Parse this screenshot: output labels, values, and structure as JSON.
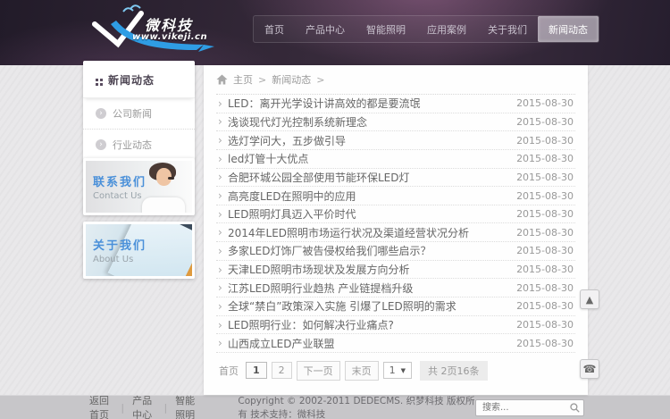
{
  "colors": {
    "accent_blue": "#4a90d9",
    "header_dark": "#2a2130",
    "footer_bg": "#c7c6c9",
    "banner_orange": "#df9b3f"
  },
  "header": {
    "logo": {
      "name": "微科技",
      "url": "www.vikeji.cn"
    },
    "nav_items": [
      {
        "label": "首页",
        "active": false
      },
      {
        "label": "产品中心",
        "active": false
      },
      {
        "label": "智能照明",
        "active": false
      },
      {
        "label": "应用案例",
        "active": false
      },
      {
        "label": "关于我们",
        "active": false
      },
      {
        "label": "新闻动态",
        "active": true
      }
    ]
  },
  "sidebar": {
    "title": "新闻动态",
    "links": [
      {
        "label": "公司新闻"
      },
      {
        "label": "行业动态"
      }
    ],
    "banners": [
      {
        "title": "联系我们",
        "subtitle": "Contact Us"
      },
      {
        "title": "关于我们",
        "subtitle": "About Us"
      }
    ]
  },
  "main": {
    "breadcrumb": {
      "items": [
        {
          "label": "主页"
        },
        {
          "label": "新闻动态"
        }
      ],
      "separator": ">"
    },
    "news_items": [
      {
        "title": "LED：离开光学设计讲高效的都是要流氓",
        "date": "2015-08-30"
      },
      {
        "title": "浅谈现代灯光控制系统新理念",
        "date": "2015-08-30"
      },
      {
        "title": "选灯学问大，五步做引导",
        "date": "2015-08-30"
      },
      {
        "title": "led灯管十大优点",
        "date": "2015-08-30"
      },
      {
        "title": "合肥环城公园全部使用节能环保LED灯",
        "date": "2015-08-30"
      },
      {
        "title": "高亮度LED在照明中的应用",
        "date": "2015-08-30"
      },
      {
        "title": "LED照明灯具迈入平价时代",
        "date": "2015-08-30"
      },
      {
        "title": "2014年LED照明市场运行状况及渠道经营状况分析",
        "date": "2015-08-30"
      },
      {
        "title": "多家LED灯饰厂被告侵权给我们哪些启示？",
        "date": "2015-08-30"
      },
      {
        "title": "天津LED照明市场现状及发展方向分析",
        "date": "2015-08-30"
      },
      {
        "title": "江苏LED照明行业趋热 产业链提档升级",
        "date": "2015-08-30"
      },
      {
        "title": "全球“禁白”政策深入实施 引爆了LED照明的需求",
        "date": "2015-08-30"
      },
      {
        "title": "LED照明行业：如何解决行业痛点?",
        "date": "2015-08-30"
      },
      {
        "title": "山西成立LED产业联盟",
        "date": "2015-08-30"
      }
    ],
    "pagination": {
      "first": "首页",
      "pages": [
        {
          "label": "1",
          "active": true
        },
        {
          "label": "2",
          "active": false
        }
      ],
      "next": "下一页",
      "last": "末页",
      "page_select": "1",
      "summary": "共 2页16条"
    }
  },
  "floating": {
    "up_arrow": "▲",
    "phone": "☎"
  },
  "footer": {
    "links": [
      {
        "label": "返回首页"
      },
      {
        "label": "产品中心"
      },
      {
        "label": "智能照明"
      }
    ],
    "copyright": "Copyright © 2002-2011 DEDECMS. 织梦科技 版权所有 技术支持：微科技",
    "search": {
      "placeholder": "搜索..."
    }
  },
  "icons": {
    "bullet": "›",
    "circle_arrow": "›",
    "select_caret": "▼"
  }
}
